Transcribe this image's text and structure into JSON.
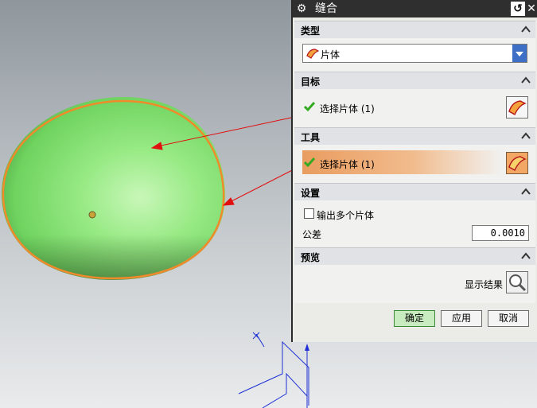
{
  "dialog": {
    "title": "缝合",
    "sections": {
      "type": {
        "label": "类型",
        "selected": "片体"
      },
      "target": {
        "label": "目标",
        "select_text": "选择片体 (1)"
      },
      "tool": {
        "label": "工具",
        "select_text": "选择片体 (1)"
      },
      "settings": {
        "label": "设置",
        "multi_output_label": "输出多个片体",
        "multi_output_checked": false,
        "tolerance_label": "公差",
        "tolerance_value": "0.0010"
      },
      "preview": {
        "label": "预览",
        "show_result_label": "显示结果"
      }
    },
    "buttons": {
      "ok": "确定",
      "apply": "应用",
      "cancel": "取消"
    }
  },
  "colors": {
    "title_bar": "#2f2f2f",
    "accent_orange": "#f0a264",
    "shape_green": "#8ee27f",
    "check_green": "#33aa22",
    "dropdown_blue": "#3d6fc6",
    "arrow_red": "#e01010",
    "axis_blue": "#1e2fd6"
  },
  "icons": [
    "gear-icon",
    "reset-icon",
    "close-icon",
    "collapse-caret-icon",
    "sheet-body-icon",
    "checkmark-icon",
    "magnifier-icon"
  ]
}
